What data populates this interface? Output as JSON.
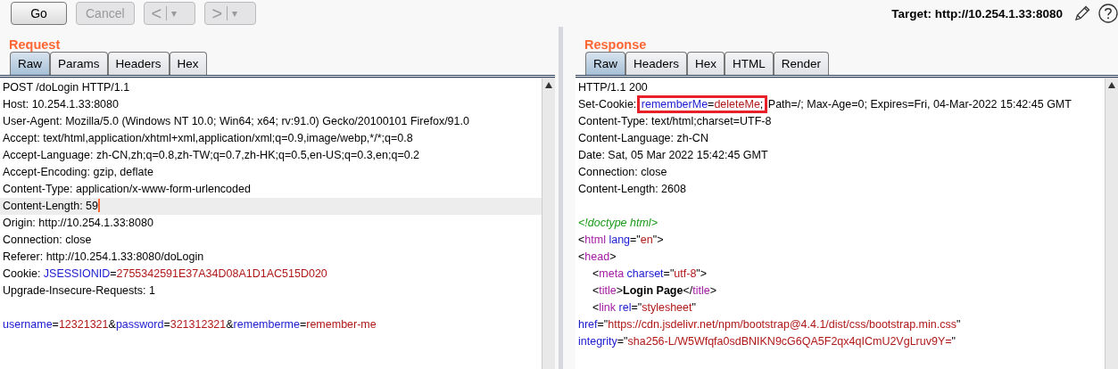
{
  "toolbar": {
    "buttons": [
      {
        "kind": "text",
        "label": "Go",
        "disabled": false
      },
      {
        "kind": "text",
        "label": "Cancel",
        "disabled": true
      },
      {
        "kind": "split",
        "label": "<",
        "menu": "▾",
        "disabled": true
      },
      {
        "kind": "split",
        "label": ">",
        "menu": "▾",
        "disabled": true
      }
    ],
    "target": "Target: http://10.254.1.33:8080"
  },
  "request": {
    "title": "Request",
    "tabs": [
      {
        "label": "Raw",
        "selected": true
      },
      {
        "label": "Params",
        "selected": false
      },
      {
        "label": "Headers",
        "selected": false
      },
      {
        "label": "Hex",
        "selected": false
      }
    ],
    "lines": [
      {
        "selected": false,
        "segments": [
          {
            "kind": "plain",
            "text": "POST /doLogin HTTP/1.1"
          }
        ]
      },
      {
        "selected": false,
        "segments": [
          {
            "kind": "plain",
            "text": "Host: 10.254.1.33:8080"
          }
        ]
      },
      {
        "selected": false,
        "segments": [
          {
            "kind": "plain",
            "text": "User-Agent: Mozilla/5.0 (Windows NT 10.0; Win64; x64; rv:91.0) Gecko/20100101 Firefox/91.0"
          }
        ]
      },
      {
        "selected": false,
        "segments": [
          {
            "kind": "plain",
            "text": "Accept: text/html,application/xhtml+xml,application/xml;q=0.9,image/webp,*/*;q=0.8"
          }
        ]
      },
      {
        "selected": false,
        "segments": [
          {
            "kind": "plain",
            "text": "Accept-Language: zh-CN,zh;q=0.8,zh-TW;q=0.7,zh-HK;q=0.5,en-US;q=0.3,en;q=0.2"
          }
        ]
      },
      {
        "selected": false,
        "segments": [
          {
            "kind": "plain",
            "text": "Accept-Encoding: gzip, deflate"
          }
        ]
      },
      {
        "selected": false,
        "segments": [
          {
            "kind": "plain",
            "text": "Content-Type: application/x-www-form-urlencoded"
          }
        ]
      },
      {
        "selected": true,
        "segments": [
          {
            "kind": "plain",
            "text": "Content-Length: 59"
          }
        ]
      },
      {
        "selected": false,
        "segments": [
          {
            "kind": "plain",
            "text": "Origin: http://10.254.1.33:8080"
          }
        ]
      },
      {
        "selected": false,
        "segments": [
          {
            "kind": "plain",
            "text": "Connection: close"
          }
        ]
      },
      {
        "selected": false,
        "segments": [
          {
            "kind": "plain",
            "text": "Referer: http://10.254.1.33:8080/doLogin"
          }
        ]
      },
      {
        "selected": false,
        "segments": [
          {
            "kind": "plain",
            "text": "Cookie: "
          },
          {
            "kind": "key",
            "text": "JSESSIONID"
          },
          {
            "kind": "plain",
            "text": "="
          },
          {
            "kind": "value",
            "text": "2755342591E37A34D08A1D1AC515D020"
          }
        ]
      },
      {
        "selected": false,
        "segments": [
          {
            "kind": "plain",
            "text": "Upgrade-Insecure-Requests: 1"
          }
        ]
      },
      {
        "selected": false
      },
      {
        "selected": false,
        "segments": [
          {
            "kind": "key",
            "text": "username"
          },
          {
            "kind": "plain",
            "text": "="
          },
          {
            "kind": "value",
            "text": "12321321"
          },
          {
            "kind": "plain",
            "text": "&"
          },
          {
            "kind": "key",
            "text": "password"
          },
          {
            "kind": "plain",
            "text": "="
          },
          {
            "kind": "value",
            "text": "321312321"
          },
          {
            "kind": "plain",
            "text": "&"
          },
          {
            "kind": "key",
            "text": "rememberme"
          },
          {
            "kind": "plain",
            "text": "="
          },
          {
            "kind": "value",
            "text": "remember-me"
          }
        ]
      }
    ]
  },
  "response": {
    "title": "Response",
    "tabs": [
      {
        "label": "Raw",
        "selected": true
      },
      {
        "label": "Headers",
        "selected": false
      },
      {
        "label": "Hex",
        "selected": false
      },
      {
        "label": "HTML",
        "selected": false
      },
      {
        "label": "Render",
        "selected": false
      }
    ],
    "lines": [
      {
        "kind": "code",
        "indented": false,
        "segments": [
          {
            "kind": "plain",
            "text": "HTTP/1.1 200"
          }
        ]
      },
      {
        "kind": "code",
        "indented": false,
        "segments": [
          {
            "kind": "plain",
            "text": "Set-Cookie: "
          },
          {
            "kind": "boxed",
            "segments": [
              {
                "kind": "key",
                "text": "rememberMe"
              },
              {
                "kind": "plain",
                "text": "="
              },
              {
                "kind": "value",
                "text": "deleteMe"
              },
              {
                "kind": "plain",
                "text": ";"
              }
            ]
          },
          {
            "kind": "plain",
            "text": " Path=/; Max-Age=0; Expires=Fri, 04-Mar-2022 15:42:45 GMT"
          }
        ]
      },
      {
        "kind": "code",
        "indented": false,
        "segments": [
          {
            "kind": "plain",
            "text": "Content-Type: text/html;charset=UTF-8"
          }
        ]
      },
      {
        "kind": "code",
        "indented": false,
        "segments": [
          {
            "kind": "plain",
            "text": "Content-Language: zh-CN"
          }
        ]
      },
      {
        "kind": "code",
        "indented": false,
        "segments": [
          {
            "kind": "plain",
            "text": "Date: Sat, 05 Mar 2022 15:42:45 GMT"
          }
        ]
      },
      {
        "kind": "code",
        "indented": false,
        "segments": [
          {
            "kind": "plain",
            "text": "Connection: close"
          }
        ]
      },
      {
        "kind": "code",
        "indented": false,
        "segments": [
          {
            "kind": "plain",
            "text": "Content-Length: 2608"
          }
        ]
      },
      {
        "kind": "blank"
      },
      {
        "kind": "code",
        "indented": false,
        "segments": [
          {
            "kind": "comment",
            "text": "<!doctype html>"
          }
        ]
      },
      {
        "kind": "code",
        "indented": false,
        "segments": [
          {
            "kind": "plain",
            "text": "<"
          },
          {
            "kind": "tag",
            "text": "html"
          },
          {
            "kind": "key",
            "text": " lang"
          },
          {
            "kind": "plain",
            "text": "=\""
          },
          {
            "kind": "value",
            "text": "en"
          },
          {
            "kind": "plain",
            "text": "\">"
          }
        ]
      },
      {
        "kind": "code",
        "indented": false,
        "segments": [
          {
            "kind": "plain",
            "text": "<"
          },
          {
            "kind": "tag",
            "text": "head"
          },
          {
            "kind": "plain",
            "text": ">"
          }
        ]
      },
      {
        "kind": "code",
        "indented": true,
        "segments": [
          {
            "kind": "plain",
            "text": "<"
          },
          {
            "kind": "tag",
            "text": "meta"
          },
          {
            "kind": "key",
            "text": " charset"
          },
          {
            "kind": "plain",
            "text": "=\""
          },
          {
            "kind": "value",
            "text": "utf-8"
          },
          {
            "kind": "plain",
            "text": "\">"
          }
        ]
      },
      {
        "kind": "code",
        "indented": true,
        "segments": [
          {
            "kind": "plain",
            "text": "<"
          },
          {
            "kind": "tag",
            "text": "title"
          },
          {
            "kind": "plain",
            "text": ">"
          },
          {
            "kind": "bold",
            "text": "Login Page"
          },
          {
            "kind": "plain",
            "text": "</"
          },
          {
            "kind": "tag",
            "text": "title"
          },
          {
            "kind": "plain",
            "text": ">"
          }
        ]
      },
      {
        "kind": "code",
        "indented": true,
        "segments": [
          {
            "kind": "plain",
            "text": "<"
          },
          {
            "kind": "tag",
            "text": "link"
          },
          {
            "kind": "key",
            "text": " rel"
          },
          {
            "kind": "plain",
            "text": "=\""
          },
          {
            "kind": "value",
            "text": "stylesheet"
          },
          {
            "kind": "plain",
            "text": "\""
          }
        ]
      },
      {
        "kind": "code",
        "indented": false,
        "segments": [
          {
            "kind": "key",
            "text": "href"
          },
          {
            "kind": "plain",
            "text": "=\""
          },
          {
            "kind": "value",
            "text": "https://cdn.jsdelivr.net/npm/bootstrap@4.4.1/dist/css/bootstrap.min.css"
          },
          {
            "kind": "plain",
            "text": "\""
          }
        ]
      },
      {
        "kind": "code",
        "indented": false,
        "segments": [
          {
            "kind": "key",
            "text": "integrity"
          },
          {
            "kind": "plain",
            "text": "=\""
          },
          {
            "kind": "value",
            "text": "sha256-L/W5Wfqfa0sdBNIKN9cG6QA5F2qx4qICmU2VgLruv9Y="
          },
          {
            "kind": "plain",
            "text": "\""
          }
        ]
      }
    ]
  }
}
